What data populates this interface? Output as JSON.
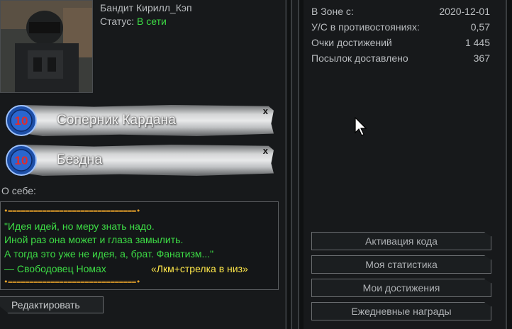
{
  "profile": {
    "name": "Бандит Кирилл_Кэп",
    "status_label": "Статус:",
    "status_value": "В сети"
  },
  "achievements": [
    {
      "badge_number": "10",
      "name": "Соперник Кардана",
      "close": "x"
    },
    {
      "badge_number": "10",
      "name": "Бездна",
      "close": "x"
    }
  ],
  "about": {
    "label": "О себе:",
    "border_line": "•==============================•",
    "lines": [
      "\"Идея идей, но меру знать надо.",
      "Иной раз она может и глаза замылить.",
      " А тогда это уже не идея, а, брат. Фанатизм...\"",
      "— Свободовец Номах"
    ],
    "hint": "«Лкм+стрелка в низ»"
  },
  "edit_button": "Редактировать",
  "stats": [
    {
      "label": "В Зоне с:",
      "value": "2020-12-01"
    },
    {
      "label": "У/С в противостояниях:",
      "value": "0,57"
    },
    {
      "label": "Очки достижений",
      "value": "1 445"
    },
    {
      "label": "Посылок доставлено",
      "value": "367"
    }
  ],
  "actions": [
    "Активация кода",
    "Моя статистика",
    "Мои достижения",
    "Ежедневные награды"
  ],
  "colors": {
    "background": "#17191b",
    "online": "#3ddc45",
    "quote": "#3ddc45",
    "hint": "#ffe84a",
    "border_dots": "#e8a32a"
  }
}
